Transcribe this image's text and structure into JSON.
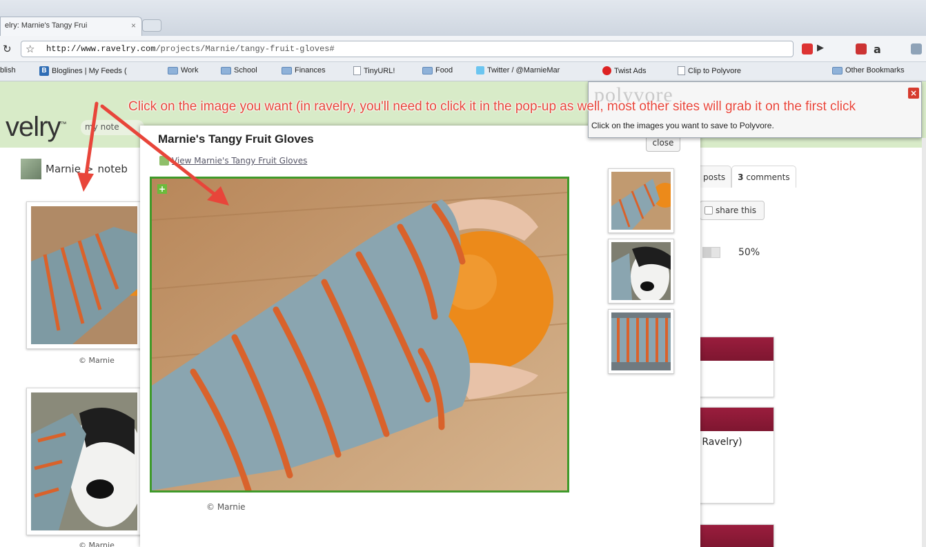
{
  "browser": {
    "tab_title": "elry: Marnie's Tangy Frui",
    "tab_close": "×",
    "url_host": "http://www.ravelry.com",
    "url_path": "/projects/Marnie/tangy-fruit-gloves#",
    "bookmarks": [
      {
        "label": "blish",
        "icon": "page"
      },
      {
        "label": "Bloglines | My Feeds (",
        "icon": "bloglines"
      },
      {
        "label": "Work",
        "icon": "folder"
      },
      {
        "label": "School",
        "icon": "folder"
      },
      {
        "label": "Finances",
        "icon": "folder"
      },
      {
        "label": "TinyURL!",
        "icon": "page"
      },
      {
        "label": "Food",
        "icon": "folder"
      },
      {
        "label": "Twitter / @MarnieMar",
        "icon": "twitter"
      },
      {
        "label": "Twist Ads",
        "icon": "red-circle"
      },
      {
        "label": "Clip to Polyvore",
        "icon": "page"
      }
    ],
    "other_bookmarks": "Other Bookmarks"
  },
  "page": {
    "logo": "velry",
    "logo_tm": "™",
    "nav_tab": "my note",
    "breadcrumb_user": "Marnie",
    "breadcrumb_sep": ">",
    "breadcrumb_page": "noteb",
    "thumb_caption_1": "© Marnie",
    "thumb_caption_2": "© Marnie",
    "tab_posts": "posts",
    "tab_comments_count": "3",
    "tab_comments": "comments",
    "share_label": "share this",
    "progress_text": "50%",
    "progress_value": 0.5,
    "ravelry_text": "n Ravelry)"
  },
  "lightbox": {
    "title": "Marnie's Tangy Fruit Gloves",
    "view_link": "View Marnie's Tangy Fruit Gloves",
    "close_label": "close",
    "caption": "© Marnie",
    "plus_label": "+"
  },
  "polyvore": {
    "logo": "polyvore",
    "instruction": "Click on the images you want to save to Polyvore.",
    "close": "×"
  },
  "annotation": {
    "text": "Click on the image you want (in ravelry, you'll need to click it in the pop-up as well, most other sites will grab it on the first click"
  },
  "colors": {
    "annotation_red": "#e8453a",
    "ravelry_green": "#d8ebc8",
    "selection_green": "#3f9a2a",
    "maroon": "#8a1a36"
  }
}
